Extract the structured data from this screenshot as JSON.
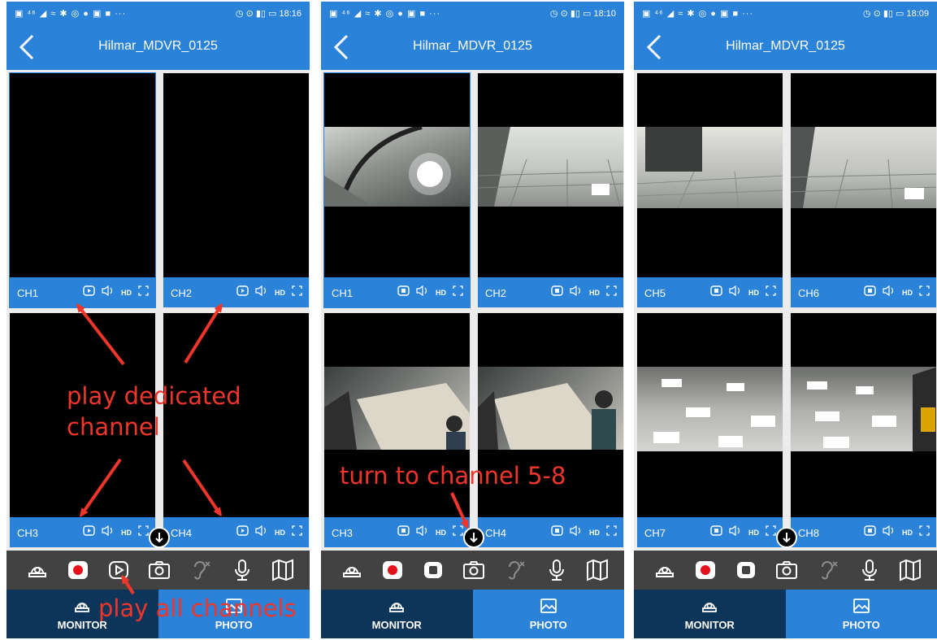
{
  "panels": [
    {
      "status_time": "18:16",
      "title": "Hilmar_MDVR_0125",
      "channels": [
        "CH1",
        "CH2",
        "CH3",
        "CH4"
      ],
      "play_icon": "play-icon",
      "pager_icon": "down-arrow-icon"
    },
    {
      "status_time": "18:10",
      "title": "Hilmar_MDVR_0125",
      "channels": [
        "CH1",
        "CH2",
        "CH3",
        "CH4"
      ],
      "play_icon": "stop-icon",
      "pager_icon": "down-arrow-icon"
    },
    {
      "status_time": "18:09",
      "title": "Hilmar_MDVR_0125",
      "channels": [
        "CH5",
        "CH6",
        "CH7",
        "CH8"
      ],
      "play_icon": "stop-icon",
      "pager_icon": "down-arrow-icon"
    }
  ],
  "cell_controls": {
    "hd_label": "HD"
  },
  "toolbar_icons": [
    "camera-dome-icon",
    "record-icon",
    "play-all-icon",
    "snapshot-icon",
    "listen-off-icon",
    "microphone-icon",
    "map-icon"
  ],
  "bottom_nav": {
    "monitor": "MONITOR",
    "photo": "PHOTO"
  },
  "annotations": {
    "play_dedicated_line1": "play dedicated",
    "play_dedicated_line2": "channel",
    "play_all": "play all channels",
    "turn_to": "turn to channel 5-8"
  },
  "colors": {
    "accent": "#2b82d9",
    "nav_dark": "#0d3559",
    "toolbar": "#424242",
    "annotation": "#f0362a",
    "record": "#e5101b"
  }
}
